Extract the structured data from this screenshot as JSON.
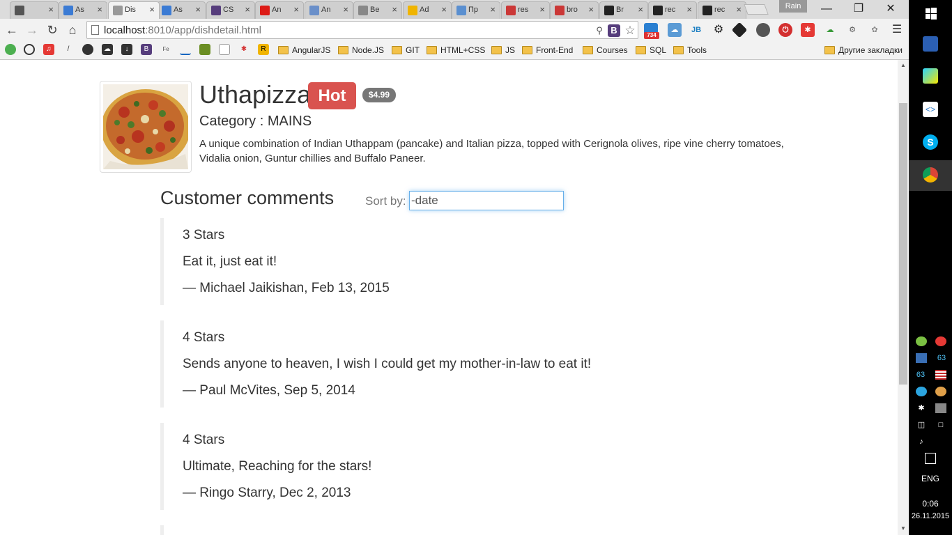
{
  "browser": {
    "tabs": [
      {
        "label": "",
        "icon": "media-icon",
        "color": "#555555"
      },
      {
        "label": "As",
        "icon": "infinity-icon",
        "color": "#3b7bd4"
      },
      {
        "label": "Dis",
        "icon": "page-icon",
        "color": "#999999"
      },
      {
        "label": "As",
        "icon": "infinity-icon",
        "color": "#3b7bd4"
      },
      {
        "label": "CS",
        "icon": "bootstrap-icon",
        "color": "#563d7c"
      },
      {
        "label": "An",
        "icon": "angular-icon",
        "color": "#dd1b16"
      },
      {
        "label": "An",
        "icon": "feather-icon",
        "color": "#6a8fc9"
      },
      {
        "label": "Be",
        "icon": "globe-icon",
        "color": "#888888"
      },
      {
        "label": "Ad",
        "icon": "bolt-icon",
        "color": "#f0b400"
      },
      {
        "label": "Пр",
        "icon": "h-icon",
        "color": "#5a8fd0"
      },
      {
        "label": "res",
        "icon": "npm-icon",
        "color": "#cb3837"
      },
      {
        "label": "bro",
        "icon": "npm-icon",
        "color": "#cb3837"
      },
      {
        "label": "Br",
        "icon": "github-icon",
        "color": "#222222"
      },
      {
        "label": "rec",
        "icon": "github-icon",
        "color": "#222222"
      },
      {
        "label": "rec",
        "icon": "github-icon",
        "color": "#222222"
      }
    ],
    "profile": "Rain",
    "url_host": "localhost",
    "url_rest": ":8010/app/dishdetail.html",
    "bookmarks": [
      "AngularJS",
      "Node.JS",
      "GIT",
      "HTML+CSS",
      "JS",
      "Front-End",
      "Courses",
      "SQL",
      "Tools"
    ],
    "other_bookmarks": "Другие закладки",
    "extension_badge": "734"
  },
  "dish": {
    "name": "Uthapizza",
    "label": "Hot",
    "price": "$4.99",
    "category": "Category : MAINS",
    "description": "A unique combination of Indian Uthappam (pancake) and Italian pizza, topped with Cerignola olives, ripe vine cherry tomatoes, Vidalia onion, Guntur chillies and Buffalo Paneer."
  },
  "comments_section": {
    "title": "Customer comments",
    "sort_label": "Sort by:",
    "sort_value": "-date"
  },
  "comments": [
    {
      "stars": "3 Stars",
      "text": "Eat it, just eat it!",
      "author": "— Michael Jaikishan, Feb 13, 2015"
    },
    {
      "stars": "4 Stars",
      "text": "Sends anyone to heaven, I wish I could get my mother-in-law to eat it!",
      "author": "— Paul McVites, Sep 5, 2014"
    },
    {
      "stars": "4 Stars",
      "text": "Ultimate, Reaching for the stars!",
      "author": "— Ringo Starry, Dec 2, 2013"
    }
  ],
  "taskbar": {
    "tray_count_a": "63",
    "tray_count_b": "63",
    "language": "ENG",
    "time": "0:06",
    "date": "26.11.2015"
  },
  "colors": {
    "hot_badge": "#d9534f",
    "price_badge": "#777777",
    "focus_border": "#66afe9"
  }
}
